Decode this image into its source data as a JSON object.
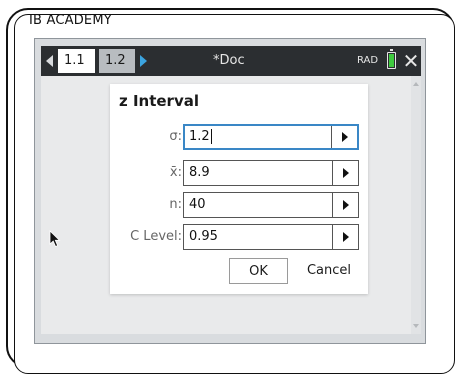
{
  "device": {
    "brand": "IB ACADEMY"
  },
  "toolbar": {
    "tabs": [
      {
        "label": "1.1",
        "active": true
      },
      {
        "label": "1.2",
        "active": false
      }
    ],
    "doc_title": "*Doc",
    "angle_mode": "RAD",
    "battery_level": 0.85,
    "accent_color": "#3ba4e0",
    "battery_color": "#3fca3f"
  },
  "dialog": {
    "title": "z Interval",
    "fields": [
      {
        "label": "σ:",
        "value": "1.2",
        "focused": true
      },
      {
        "label": "x̄:",
        "value": "8.9",
        "focused": false
      },
      {
        "label": "n:",
        "value": "40",
        "focused": false
      },
      {
        "label": "C Level:",
        "value": "0.95",
        "focused": false
      }
    ],
    "ok_label": "OK",
    "cancel_label": "Cancel",
    "focus_color": "#3a87c6"
  }
}
